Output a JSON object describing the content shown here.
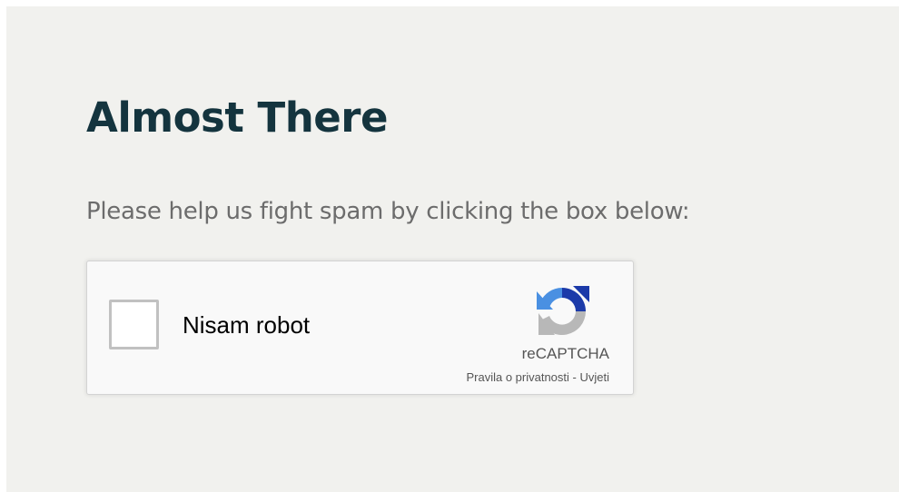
{
  "page": {
    "title": "Almost There",
    "instruction": "Please help us fight spam by clicking the box below:"
  },
  "recaptcha": {
    "checkbox_label": "Nisam robot",
    "checked": false,
    "brand": "reCAPTCHA",
    "privacy_link": "Pravila o privatnosti",
    "separator": " - ",
    "terms_link": "Uvjeti",
    "logo_icon": "recaptcha-logo-icon"
  },
  "colors": {
    "background": "#f1f1ee",
    "title": "#14343e",
    "instruction": "#6c6c6c",
    "widget_background": "#f9f9f9",
    "widget_border": "#d3d3d3",
    "logo_blue": "#4a90e2",
    "logo_dark_blue": "#1c3aa9",
    "logo_gray": "#b8b8b8"
  }
}
